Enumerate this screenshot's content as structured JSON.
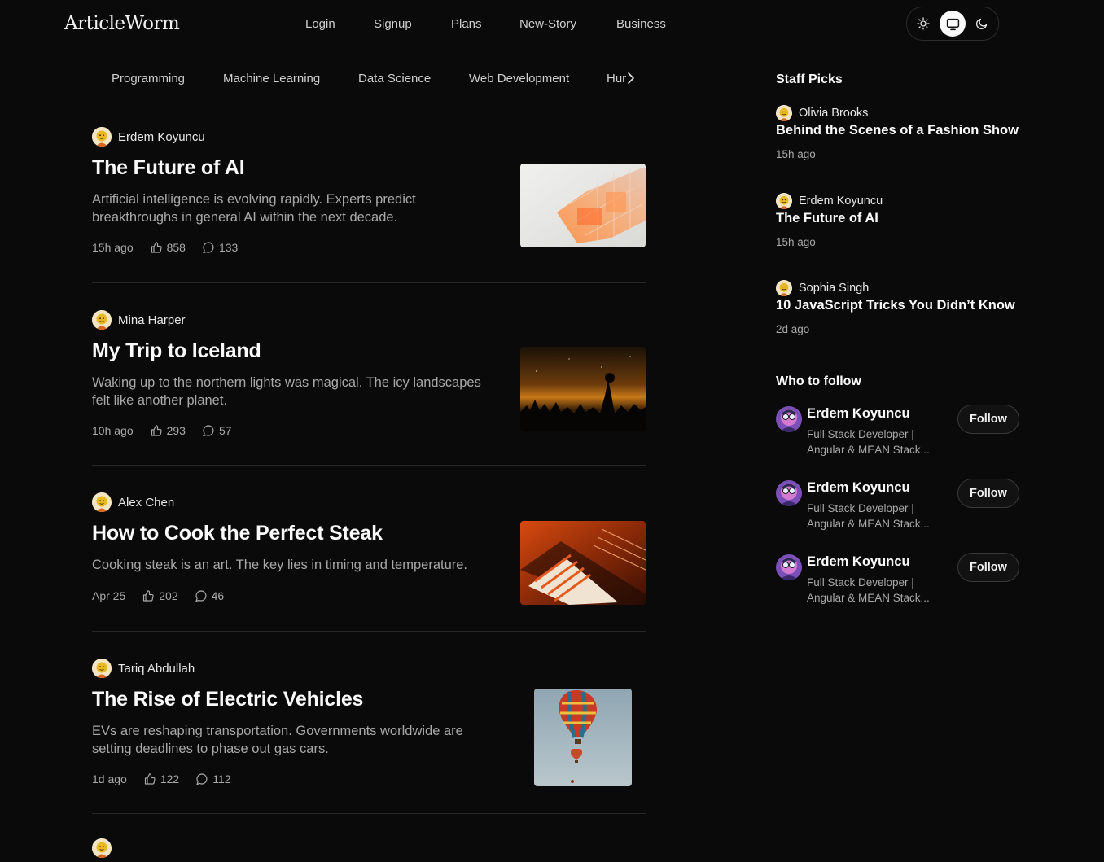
{
  "header": {
    "logo": "ArticleWorm",
    "nav": [
      "Login",
      "Signup",
      "Plans",
      "New-Story",
      "Business"
    ],
    "theme_options": [
      "sun-icon",
      "monitor-icon",
      "moon-icon"
    ],
    "theme_active": "monitor-icon"
  },
  "categories": {
    "items": [
      "Programming",
      "Machine Learning",
      "Data Science",
      "Web Development"
    ],
    "partial": "Humor"
  },
  "articles": [
    {
      "author": "Erdem Koyuncu",
      "title": "The Future of AI",
      "desc": "Artificial intelligence is evolving rapidly. Experts predict breakthroughs in general AI within the next decade.",
      "time": "15h ago",
      "likes": "858",
      "comments": "133",
      "image": "abstract-orange-glass"
    },
    {
      "author": "Mina Harper",
      "title": "My Trip to Iceland",
      "desc": "Waking up to the northern lights was magical. The icy landscapes felt like another planet.",
      "time": "10h ago",
      "likes": "293",
      "comments": "57",
      "image": "night-forest-sky"
    },
    {
      "author": "Alex Chen",
      "title": "How to Cook the Perfect Steak",
      "desc": "Cooking steak is an art. The key lies in timing and temperature.",
      "time": "Apr 25",
      "likes": "202",
      "comments": "46",
      "image": "orange-architecture"
    },
    {
      "author": "Tariq Abdullah",
      "title": "The Rise of Electric Vehicles",
      "desc": "EVs are reshaping transportation. Governments worldwide are setting deadlines to phase out gas cars.",
      "time": "1d ago",
      "likes": "122",
      "comments": "112",
      "image": "hot-air-balloons"
    }
  ],
  "sidebar": {
    "staff_picks_title": "Staff Picks",
    "staff_picks": [
      {
        "author": "Olivia Brooks",
        "title": "Behind the Scenes of a Fashion Show",
        "time": "15h ago"
      },
      {
        "author": "Erdem Koyuncu",
        "title": "The Future of AI",
        "time": "15h ago"
      },
      {
        "author": "Sophia Singh",
        "title": "10 JavaScript Tricks You Didn’t Know",
        "time": "2d ago"
      }
    ],
    "who_to_follow_title": "Who to follow",
    "who_to_follow": [
      {
        "name": "Erdem Koyuncu",
        "bio": "Full Stack Developer | Angular & MEAN Stack...",
        "button": "Follow"
      },
      {
        "name": "Erdem Koyuncu",
        "bio": "Full Stack Developer | Angular & MEAN Stack...",
        "button": "Follow"
      },
      {
        "name": "Erdem Koyuncu",
        "bio": "Full Stack Developer | Angular & MEAN Stack...",
        "button": "Follow"
      }
    ]
  },
  "colors": {
    "background": "#0a0a0a",
    "text": "#fafafa",
    "muted": "#a9a9a9",
    "divider": "#262626"
  }
}
